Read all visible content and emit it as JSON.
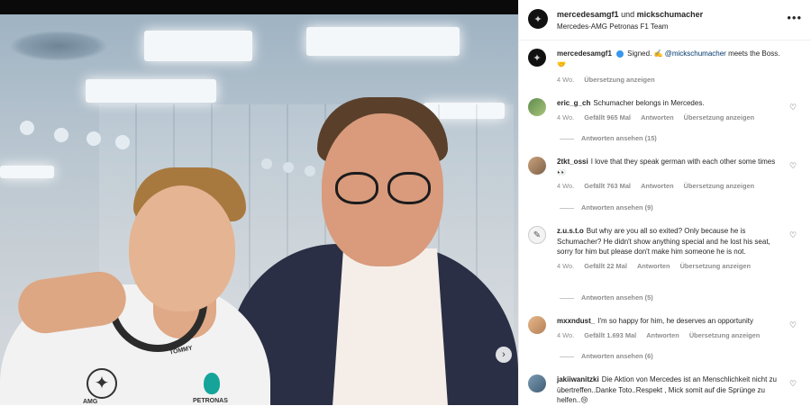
{
  "post_image": {
    "shirt_brand": "AMG",
    "shirt_sponsor": "PETRONAS",
    "shirt_name": "TOMMY"
  },
  "header": {
    "title_user1": "mercedesamgf1",
    "title_joiner": "und",
    "title_user2": "mickschumacher",
    "subtitle": "Mercedes-AMG Petronas F1 Team",
    "more_icon": "more-horizontal-icon"
  },
  "caption": {
    "user": "mercedesamgf1",
    "text_before": "Signed. ✍️ ",
    "mention": "@mickschumacher",
    "text_after": " meets the Boss. 🤝",
    "time": "4 Wo.",
    "translate": "Übersetzung anzeigen"
  },
  "comments": [
    {
      "user": "eric_g_ch",
      "text": "Schumacher belongs in Mercedes.",
      "time": "4 Wo.",
      "likes": "Gefällt 965 Mal",
      "reply": "Antworten",
      "translate": "Übersetzung anzeigen",
      "replies": "Antworten ansehen (15)"
    },
    {
      "user": "2tkt_ossi",
      "text": "I love that they speak german with each other some times 👀",
      "time": "4 Wo.",
      "likes": "Gefällt 763 Mal",
      "reply": "Antworten",
      "translate": "Übersetzung anzeigen",
      "replies": "Antworten ansehen (9)"
    },
    {
      "user": "z.u.s.t.o",
      "text": "But why are you all so exited? Only because he is Schumacher? He didn't show anything special and he lost his seat, sorry for him but please don't make him someone he is not.",
      "time": "4 Wo.",
      "likes": "Gefällt 22 Mal",
      "reply": "Antworten",
      "translate": "Übersetzung anzeigen",
      "replies": "Antworten ansehen (5)"
    },
    {
      "user": "mxxndust_",
      "text": "I'm so happy for him, he deserves an opportunity",
      "time": "4 Wo.",
      "likes": "Gefällt 1.693 Mal",
      "reply": "Antworten",
      "translate": "Übersetzung anzeigen",
      "replies": "Antworten ansehen (6)"
    },
    {
      "user": "jakiiwanitzki",
      "text": "Die Aktion von Mercedes ist an Menschlichkeit nicht zu übertreffen..Danke Toto..Respekt , Mick somit auf die Sprünge zu helfen..😢",
      "time": "",
      "likes": "",
      "reply": "",
      "translate": "",
      "replies": ""
    }
  ],
  "carousel": {
    "next_icon": "chevron-right-icon"
  },
  "colors": {
    "meta_gray": "#8e8e8e",
    "mention_blue": "#00376b",
    "text": "#262626"
  }
}
